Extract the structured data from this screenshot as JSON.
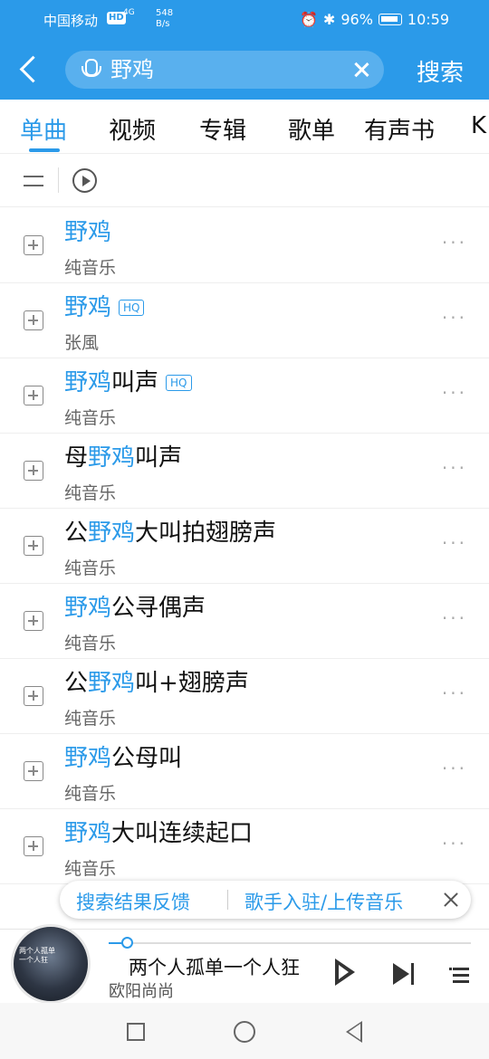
{
  "status_bar": {
    "carrier": "中国移动",
    "hd": "HD",
    "network": "4G",
    "speed_value": "548",
    "speed_unit": "B/s",
    "battery": "96%",
    "time": "10:59"
  },
  "search": {
    "query": "野鸡",
    "button_label": "搜索"
  },
  "tabs": [
    "单曲",
    "视频",
    "专辑",
    "歌单",
    "有声书",
    "K"
  ],
  "active_tab": "单曲",
  "songs": [
    {
      "pre": "",
      "hl": "野鸡",
      "post": "",
      "hq": "",
      "artist": "纯音乐"
    },
    {
      "pre": "",
      "hl": "野鸡",
      "post": "",
      "hq": "HQ",
      "artist": "张風"
    },
    {
      "pre": "",
      "hl": "野鸡",
      "post": "叫声",
      "hq": "HQ",
      "artist": "纯音乐"
    },
    {
      "pre": "母",
      "hl": "野鸡",
      "post": "叫声",
      "hq": "",
      "artist": "纯音乐"
    },
    {
      "pre": "公",
      "hl": "野鸡",
      "post": "大叫拍翅膀声",
      "hq": "",
      "artist": "纯音乐"
    },
    {
      "pre": "",
      "hl": "野鸡",
      "post": "公寻偶声",
      "hq": "",
      "artist": "纯音乐"
    },
    {
      "pre": "公",
      "hl": "野鸡",
      "post": "叫+翅膀声",
      "hq": "",
      "artist": "纯音乐"
    },
    {
      "pre": "",
      "hl": "野鸡",
      "post": "公母叫",
      "hq": "",
      "artist": "纯音乐"
    },
    {
      "pre": "",
      "hl": "野鸡",
      "post": "大叫连续起口",
      "hq": "",
      "artist": "纯音乐"
    }
  ],
  "more_glyph": "···",
  "feedback": {
    "link1": "搜索结果反馈",
    "link2": "歌手入驻/上传音乐"
  },
  "player": {
    "title": "两个人孤单一个人狂",
    "artist": "欧阳尚尚",
    "progress": 0.05,
    "cover_text": "两个人孤单一个人狂"
  },
  "colors": {
    "accent": "#2b9ae9",
    "header": "#2b9ae9"
  },
  "icons": [
    "back-icon",
    "mic-icon",
    "clear-icon",
    "sort-icon",
    "play-all-icon",
    "add-icon",
    "more-icon",
    "close-icon",
    "play-icon",
    "next-icon",
    "playlist-icon"
  ]
}
